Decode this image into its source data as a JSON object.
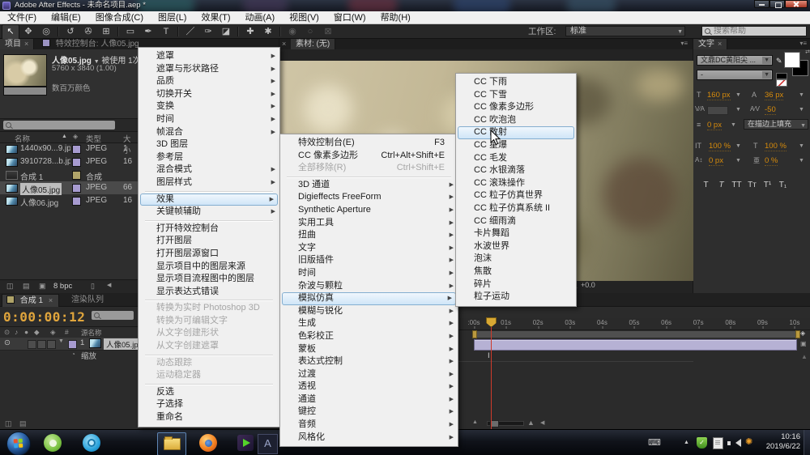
{
  "window": {
    "title": "Adobe After Effects - 未命名项目.aep *"
  },
  "colors": {
    "accent_orange": "#d78b0b",
    "label_violet": "#a79bd0",
    "label_tan": "#b0a469",
    "menu_highlight_border": "#84aed0",
    "layer_bar": "#b6b1d4",
    "playhead": "#d8a833",
    "time_indicator_red": "#cf3a2b"
  },
  "icons": {
    "close": "×",
    "dropdown": "▼",
    "sort_asc": "▲",
    "submenu_arrow": "▶",
    "panel_menu": "▾≡",
    "tag": "◈",
    "hash": "#",
    "eye": "⊙",
    "audio": "♪",
    "solo": "●",
    "lock": "◆",
    "stopwatch": "◔",
    "collapse_left": "◀",
    "interpret_footage": "◫",
    "folder": "▤",
    "new_comp": "▣",
    "trash": "▯",
    "eyedropper": "✎",
    "swap": "⇄",
    "font_size_T": "T",
    "leading_A": "A",
    "kern_VA": "V⁄A",
    "track_AV": "A⁄V",
    "stroke_lines": "≡",
    "vscale_IT": "IT",
    "hscale_T": "T",
    "baseline_A": "A↕",
    "tsume": "亜",
    "shield_comp": "◈",
    "cam_mini": "▣",
    "tri_up": "▲",
    "mountain_small": "▲",
    "mountain_big": "▲",
    "keyboard": "⌨",
    "tray_expand": "▲",
    "tray_flower": "✺",
    "check": "✓",
    "grid": "⊞",
    "keyframe_marker": "Ⅰ"
  },
  "menubar": {
    "items": [
      "文件(F)",
      "编辑(E)",
      "图像合成(C)",
      "图层(L)",
      "效果(T)",
      "动画(A)",
      "视图(V)",
      "窗口(W)",
      "帮助(H)"
    ]
  },
  "toolbar": {
    "tools": [
      "↖",
      "✥",
      "◎",
      "↺",
      "✇",
      "⊞",
      "▭",
      "✒",
      "T",
      "／",
      "✑",
      "◪",
      "✚",
      "✱"
    ],
    "tools_disabled": [
      "◉",
      "○",
      "⊠"
    ],
    "workspace_label": "工作区:",
    "workspace_value": "标准",
    "search_placeholder": "搜索帮助"
  },
  "project": {
    "tab": "项目",
    "effects_tab": "特效控制台: 人像05.jpg",
    "preview": {
      "name": "人像05.jpg",
      "usage": "被使用 1次",
      "dimensions": "5760 x 3840 (1.00)",
      "colors": "数百万颜色"
    },
    "columns": {
      "name": "名称",
      "type": "类型",
      "size": "大小"
    },
    "files": [
      {
        "name": "1440x90...9.jpg",
        "type": "JPEG",
        "size": "1",
        "label": "label_violet",
        "kind": "img",
        "selected": false
      },
      {
        "name": "3910728...b.jpg",
        "type": "JPEG",
        "size": "16",
        "label": "label_violet",
        "kind": "img",
        "selected": false
      },
      {
        "name": "合成 1",
        "type": "合成",
        "size": "",
        "label": "label_tan",
        "kind": "comp",
        "selected": false
      },
      {
        "name": "人像05.jpg",
        "type": "JPEG",
        "size": "66",
        "label": "label_violet",
        "kind": "img",
        "selected": true
      },
      {
        "name": "人像06.jpg",
        "type": "JPEG",
        "size": "16",
        "label": "label_violet",
        "kind": "img",
        "selected": false
      }
    ],
    "footer_bpc": "8 bpc"
  },
  "viewer": {
    "tab": "素材: (无)",
    "zoom_value": "+0.0"
  },
  "charpanel": {
    "tab": "文字",
    "font_family": "文鼎DC黄阳尖 ...",
    "font_style": "-",
    "font_size": "160 px",
    "leading": "36 px",
    "tracking": "-50",
    "stroke_width": "0 px",
    "fill_mode": "在描边上填充",
    "v_scale": "100 %",
    "h_scale": "100 %",
    "baseline": "0 px",
    "tsume": "0 %",
    "style_buttons": [
      "T",
      "T",
      "TT",
      "Tᴛ",
      "T¹",
      "T₁"
    ]
  },
  "menu1": {
    "items": [
      {
        "label": "遮罩",
        "arrow": true
      },
      {
        "label": "遮罩与形状路径",
        "arrow": true
      },
      {
        "label": "品质",
        "arrow": true
      },
      {
        "label": "切换开关",
        "arrow": true
      },
      {
        "label": "变换",
        "arrow": true
      },
      {
        "label": "时间",
        "arrow": true
      },
      {
        "label": "帧混合",
        "arrow": true
      },
      {
        "label": "3D 图层"
      },
      {
        "label": "参考层"
      },
      {
        "label": "混合模式",
        "arrow": true
      },
      {
        "label": "图层样式",
        "arrow": true
      },
      {
        "sep": true
      },
      {
        "label": "效果",
        "arrow": true,
        "highlight": true
      },
      {
        "label": "关键帧辅助",
        "arrow": true
      },
      {
        "sep": true
      },
      {
        "label": "打开特效控制台"
      },
      {
        "label": "打开图层"
      },
      {
        "label": "打开图层源窗口"
      },
      {
        "label": "显示项目中的图层来源"
      },
      {
        "label": "显示项目流程图中的图层"
      },
      {
        "label": "显示表达式错误"
      },
      {
        "sep": true
      },
      {
        "label": "转换为实时 Photoshop 3D",
        "disabled": true
      },
      {
        "label": "转换为可编辑文字",
        "disabled": true
      },
      {
        "label": "从文字创建形状",
        "disabled": true
      },
      {
        "label": "从文字创建遮罩",
        "disabled": true
      },
      {
        "sep": true
      },
      {
        "label": "动态跟踪",
        "disabled": true
      },
      {
        "label": "运动稳定器",
        "disabled": true
      },
      {
        "sep": true
      },
      {
        "label": "反选"
      },
      {
        "label": "子选择"
      },
      {
        "label": "重命名"
      }
    ]
  },
  "menu2": {
    "items": [
      {
        "label": "特效控制台(E)",
        "shortcut": "F3"
      },
      {
        "label": "CC 像素多边形",
        "shortcut": "Ctrl+Alt+Shift+E"
      },
      {
        "label": "全部移除(R)",
        "shortcut": "Ctrl+Shift+E",
        "disabled": true
      },
      {
        "sep": true
      },
      {
        "label": "3D 通道",
        "arrow": true
      },
      {
        "label": "Digieffects FreeForm",
        "arrow": true
      },
      {
        "label": "Synthetic Aperture",
        "arrow": true
      },
      {
        "label": "实用工具",
        "arrow": true
      },
      {
        "label": "扭曲",
        "arrow": true
      },
      {
        "label": "文字",
        "arrow": true
      },
      {
        "label": "旧版插件",
        "arrow": true
      },
      {
        "label": "时间",
        "arrow": true
      },
      {
        "label": "杂波与颗粒",
        "arrow": true
      },
      {
        "label": "模拟仿真",
        "arrow": true,
        "highlight": true
      },
      {
        "label": "模糊与锐化",
        "arrow": true
      },
      {
        "label": "生成",
        "arrow": true
      },
      {
        "label": "色彩校正",
        "arrow": true
      },
      {
        "label": "蒙板",
        "arrow": true
      },
      {
        "label": "表达式控制",
        "arrow": true
      },
      {
        "label": "过渡",
        "arrow": true
      },
      {
        "label": "透视",
        "arrow": true
      },
      {
        "label": "通道",
        "arrow": true
      },
      {
        "label": "键控",
        "arrow": true
      },
      {
        "label": "音频",
        "arrow": true
      },
      {
        "label": "风格化",
        "arrow": true
      }
    ]
  },
  "menu3": {
    "items": [
      {
        "label": "CC 下雨"
      },
      {
        "label": "CC 下雪"
      },
      {
        "label": "CC 像素多边形"
      },
      {
        "label": "CC 吹泡泡"
      },
      {
        "label": "CC 散射",
        "highlight": true
      },
      {
        "label": "CC 星爆"
      },
      {
        "label": "CC 毛发"
      },
      {
        "label": "CC 水银滴落"
      },
      {
        "label": "CC 滚珠操作"
      },
      {
        "label": "CC 粒子仿真世界"
      },
      {
        "label": "CC 粒子仿真系统 II"
      },
      {
        "label": "CC 细雨滴"
      },
      {
        "label": "卡片舞蹈"
      },
      {
        "label": "水波世界"
      },
      {
        "label": "泡沫"
      },
      {
        "label": "焦散"
      },
      {
        "label": "碎片"
      },
      {
        "label": "粒子运动"
      }
    ]
  },
  "timeline": {
    "comp_tab": "合成 1",
    "queue_tab": "渲染队列",
    "timecode": "0:00:00:12",
    "source_name_col": "源名称",
    "layer_index": "1",
    "layer_name": "人像05.jpg",
    "scale_property": "缩放",
    "ruler": [
      ":00s",
      "01s",
      "02s",
      "03s",
      "04s",
      "05s",
      "06s",
      "07s",
      "08s",
      "09s",
      "10s"
    ]
  },
  "taskbar": {
    "time": "10:16",
    "date": "2019/6/22"
  }
}
